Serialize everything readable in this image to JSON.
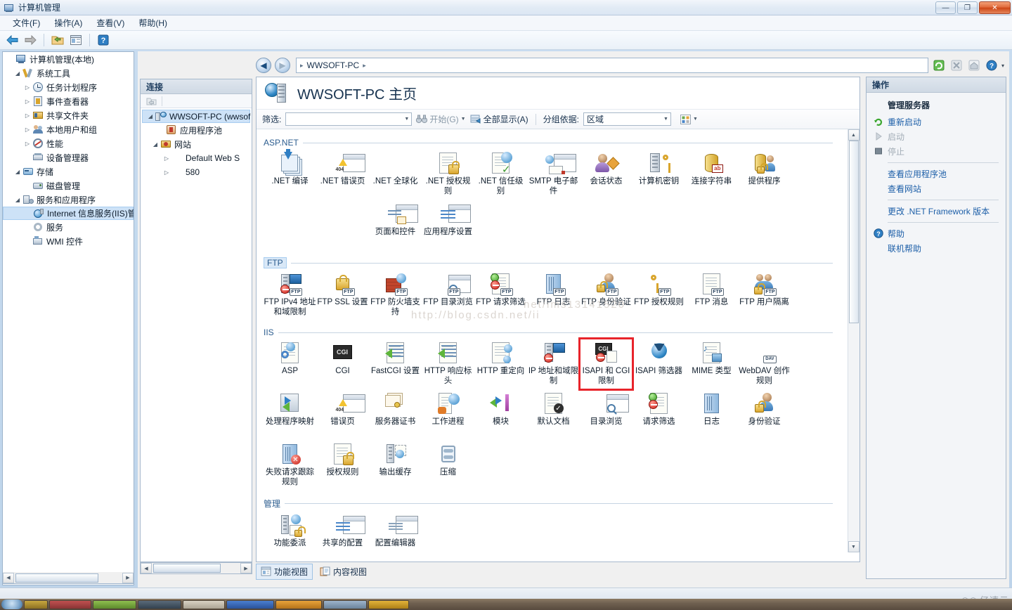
{
  "window": {
    "title": "计算机管理",
    "icon": "computer-management-icon",
    "minimize": "—",
    "maximize": "❐",
    "close": "✕"
  },
  "menubar": {
    "items": [
      {
        "label": "文件(F)"
      },
      {
        "label": "操作(A)"
      },
      {
        "label": "查看(V)"
      },
      {
        "label": "帮助(H)"
      }
    ]
  },
  "toolbar": {
    "items": [
      {
        "name": "back-icon",
        "glyph": "⬅"
      },
      {
        "name": "forward-icon",
        "glyph": "➡"
      },
      {
        "name": "show-hide-console-tree-icon",
        "glyph": "📂"
      },
      {
        "name": "properties-icon",
        "glyph": "▤"
      },
      {
        "name": "help-icon",
        "glyph": "?"
      }
    ]
  },
  "mmc_tree": {
    "root": {
      "label": "计算机管理(本地)",
      "icon": "computer-icon"
    },
    "items": [
      {
        "label": "系统工具",
        "icon": "system-tools-icon",
        "indent": 1,
        "twisty": "expanded"
      },
      {
        "label": "任务计划程序",
        "icon": "task-scheduler-icon",
        "indent": 2,
        "twisty": "collapsed"
      },
      {
        "label": "事件查看器",
        "icon": "event-viewer-icon",
        "indent": 2,
        "twisty": "collapsed"
      },
      {
        "label": "共享文件夹",
        "icon": "shared-folders-icon",
        "indent": 2,
        "twisty": "collapsed"
      },
      {
        "label": "本地用户和组",
        "icon": "local-users-groups-icon",
        "indent": 2,
        "twisty": "collapsed"
      },
      {
        "label": "性能",
        "icon": "performance-icon",
        "indent": 2,
        "twisty": "collapsed"
      },
      {
        "label": "设备管理器",
        "icon": "device-manager-icon",
        "indent": 2,
        "twisty": "none"
      },
      {
        "label": "存储",
        "icon": "storage-icon",
        "indent": 1,
        "twisty": "expanded"
      },
      {
        "label": "磁盘管理",
        "icon": "disk-management-icon",
        "indent": 2,
        "twisty": "none"
      },
      {
        "label": "服务和应用程序",
        "icon": "services-applications-icon",
        "indent": 1,
        "twisty": "expanded"
      },
      {
        "label": "Internet 信息服务(IIS)管",
        "icon": "iis-manager-icon",
        "indent": 2,
        "twisty": "none",
        "selected": true
      },
      {
        "label": "服务",
        "icon": "services-icon",
        "indent": 2,
        "twisty": "none"
      },
      {
        "label": "WMI 控件",
        "icon": "wmi-control-icon",
        "indent": 2,
        "twisty": "none"
      }
    ]
  },
  "connections": {
    "header": "连接",
    "toolbar_icon": "connection-tasks-icon",
    "items": [
      {
        "label": "WWSOFT-PC (wwsof",
        "icon": "server-node-icon",
        "indent": 0,
        "twisty": "expanded",
        "selected": true
      },
      {
        "label": "应用程序池",
        "icon": "app-pools-icon",
        "indent": 1,
        "twisty": "none"
      },
      {
        "label": "网站",
        "icon": "sites-folder-icon",
        "indent": 1,
        "twisty": "expanded"
      },
      {
        "label": "Default Web S",
        "icon": "website-icon",
        "indent": 2,
        "twisty": "collapsed"
      },
      {
        "label": "580",
        "icon": "website-icon",
        "indent": 2,
        "twisty": "collapsed"
      }
    ]
  },
  "breadcrumb": {
    "back_glyph": "◀",
    "forward_glyph": "▶",
    "start_glyph": "▸",
    "segments": [
      "WWSOFT-PC"
    ],
    "separator": "▸",
    "right_icons": [
      {
        "name": "refresh-icon",
        "glyph": "⟳"
      },
      {
        "name": "stop-icon",
        "glyph": "✕"
      },
      {
        "name": "home-icon",
        "glyph": "⌂"
      },
      {
        "name": "help-icon",
        "glyph": "?"
      },
      {
        "name": "chevron-down-icon",
        "glyph": "▾"
      }
    ]
  },
  "feature_view": {
    "page_title": "WWSOFT-PC 主页",
    "page_icon": "server-home-icon",
    "filter_label": "筛选:",
    "filter_value": "",
    "go_label": "开始(G)",
    "show_all_label": "全部显示(A)",
    "group_by_label": "分组依据:",
    "group_by_value": "区域",
    "view_mode_icon": "view-mode-icon",
    "groups": [
      {
        "name": "ASP.NET",
        "items": [
          {
            "label": ".NET 编译",
            "icon": "net-compilation-icon"
          },
          {
            "label": ".NET 错误页",
            "icon": "net-error-pages-icon"
          },
          {
            "label": ".NET 全球化",
            "icon": "net-globalization-icon"
          },
          {
            "label": ".NET 授权规则",
            "icon": "net-authorization-rules-icon"
          },
          {
            "label": ".NET 信任级别",
            "icon": "net-trust-levels-icon"
          },
          {
            "label": "SMTP 电子邮件",
            "icon": "smtp-email-icon"
          },
          {
            "label": "会话状态",
            "icon": "session-state-icon"
          },
          {
            "label": "计算机密钥",
            "icon": "machine-key-icon"
          },
          {
            "label": "连接字符串",
            "icon": "connection-strings-icon"
          },
          {
            "label": "提供程序",
            "icon": "providers-icon"
          },
          {
            "label": "页面和控件",
            "icon": "pages-controls-icon"
          },
          {
            "label": "应用程序设置",
            "icon": "application-settings-icon"
          }
        ]
      },
      {
        "name": "FTP",
        "selected": true,
        "items": [
          {
            "label": "FTP IPv4 地址和域限制",
            "icon": "ftp-ipv4-restrictions-icon"
          },
          {
            "label": "FTP SSL 设置",
            "icon": "ftp-ssl-settings-icon"
          },
          {
            "label": "FTP 防火墙支持",
            "icon": "ftp-firewall-support-icon"
          },
          {
            "label": "FTP 目录浏览",
            "icon": "ftp-directory-browsing-icon"
          },
          {
            "label": "FTP 请求筛选",
            "icon": "ftp-request-filtering-icon"
          },
          {
            "label": "FTP 日志",
            "icon": "ftp-logging-icon"
          },
          {
            "label": "FTP 身份验证",
            "icon": "ftp-authentication-icon"
          },
          {
            "label": "FTP 授权规则",
            "icon": "ftp-authorization-rules-icon"
          },
          {
            "label": "FTP 消息",
            "icon": "ftp-messages-icon"
          },
          {
            "label": "FTP 用户隔离",
            "icon": "ftp-user-isolation-icon"
          }
        ]
      },
      {
        "name": "IIS",
        "items": [
          {
            "label": "ASP",
            "icon": "asp-icon"
          },
          {
            "label": "CGI",
            "icon": "cgi-icon"
          },
          {
            "label": "FastCGI 设置",
            "icon": "fastcgi-settings-icon"
          },
          {
            "label": "HTTP 响应标头",
            "icon": "http-response-headers-icon"
          },
          {
            "label": "HTTP 重定向",
            "icon": "http-redirect-icon"
          },
          {
            "label": "IP 地址和域限制",
            "icon": "ip-domain-restrictions-icon"
          },
          {
            "label": "ISAPI 和 CGI 限制",
            "icon": "isapi-cgi-restrictions-icon",
            "highlighted": true
          },
          {
            "label": "ISAPI 筛选器",
            "icon": "isapi-filters-icon"
          },
          {
            "label": "MIME 类型",
            "icon": "mime-types-icon"
          },
          {
            "label": "WebDAV 创作规则",
            "icon": "webdav-authoring-rules-icon"
          },
          {
            "label": "处理程序映射",
            "icon": "handler-mappings-icon"
          },
          {
            "label": "错误页",
            "icon": "error-pages-icon"
          },
          {
            "label": "服务器证书",
            "icon": "server-certificates-icon"
          },
          {
            "label": "工作进程",
            "icon": "worker-processes-icon"
          },
          {
            "label": "模块",
            "icon": "modules-icon"
          },
          {
            "label": "默认文档",
            "icon": "default-document-icon"
          },
          {
            "label": "目录浏览",
            "icon": "directory-browsing-icon"
          },
          {
            "label": "请求筛选",
            "icon": "request-filtering-icon"
          },
          {
            "label": "日志",
            "icon": "logging-icon"
          },
          {
            "label": "身份验证",
            "icon": "authentication-icon"
          },
          {
            "label": "失败请求跟踪规则",
            "icon": "failed-request-tracing-rules-icon"
          },
          {
            "label": "授权规则",
            "icon": "authorization-rules-icon"
          },
          {
            "label": "输出缓存",
            "icon": "output-caching-icon"
          },
          {
            "label": "压缩",
            "icon": "compression-icon"
          }
        ]
      },
      {
        "name": "管理",
        "items": [
          {
            "label": "功能委派",
            "icon": "feature-delegation-icon"
          },
          {
            "label": "共享的配置",
            "icon": "shared-configuration-icon"
          },
          {
            "label": "配置编辑器",
            "icon": "configuration-editor-icon"
          }
        ]
      }
    ]
  },
  "view_tabs": [
    {
      "label": "功能视图",
      "icon": "features-view-icon",
      "active": true
    },
    {
      "label": "内容视图",
      "icon": "content-view-icon",
      "active": false
    }
  ],
  "actions": {
    "header": "操作",
    "section_title": "管理服务器",
    "items": [
      {
        "label": "重新启动",
        "icon": "restart-icon",
        "disabled": false
      },
      {
        "label": "启动",
        "icon": "start-icon",
        "disabled": true
      },
      {
        "label": "停止",
        "icon": "stop-icon",
        "disabled": true
      },
      {
        "divider": true
      },
      {
        "label": "查看应用程序池",
        "icon": "",
        "disabled": false
      },
      {
        "label": "查看网站",
        "icon": "",
        "disabled": false
      },
      {
        "divider": true
      },
      {
        "label": "更改 .NET Framework 版本",
        "icon": "",
        "disabled": false
      },
      {
        "divider": true
      },
      {
        "label": "帮助",
        "icon": "help-icon",
        "disabled": false
      },
      {
        "label": "联机帮助",
        "icon": "",
        "disabled": false
      }
    ]
  },
  "watermarks": {
    "corner": "亿速云",
    "corner_glyph": "◎◎",
    "ghost_left": "http://blog.csdn.net/ii",
    "ghost_right": "net/ims13141520"
  },
  "colors": {
    "highlight_red": "#e8242b",
    "link_blue": "#1d5fa8",
    "group_label": "#2c5d8f",
    "selection": "#cde2f7"
  }
}
